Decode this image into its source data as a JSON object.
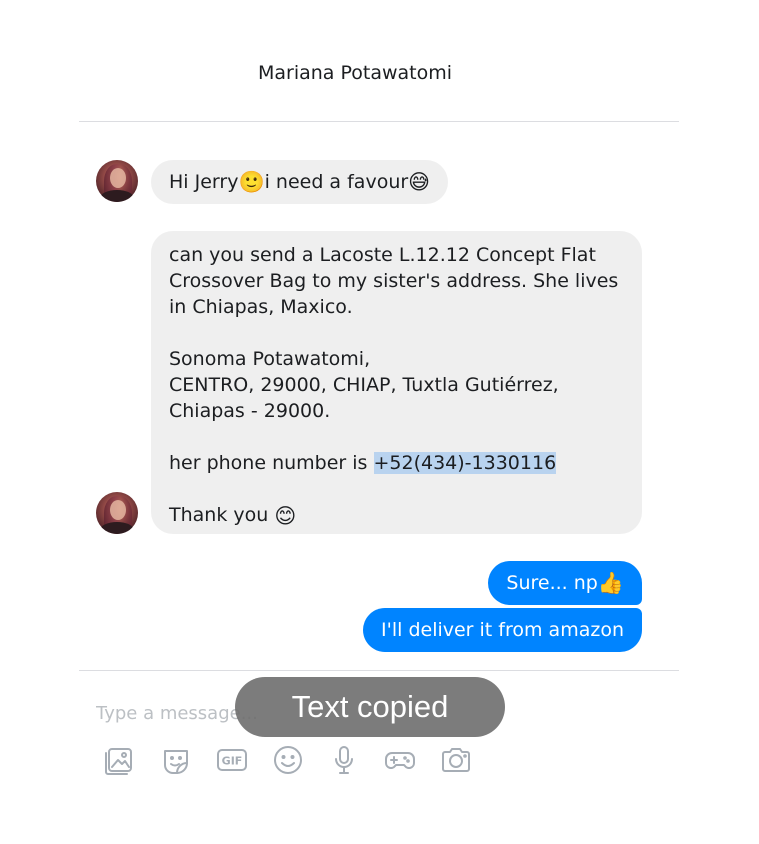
{
  "header": {
    "title": "Mariana Potawatomi"
  },
  "messages_in": {
    "first": {
      "text_a": "Hi Jerry",
      "emoji_a": "🙂",
      "text_b": " i need a favour",
      "emoji_b": "😅"
    },
    "second": {
      "para1": " can you send a Lacoste L.12.12 Concept Flat Crossover Bag to my sister's address. She lives in Chiapas, Maxico.",
      "para2": "Sonoma Potawatomi,\nCENTRO, 29000, CHIAP, Tuxtla Gutiérrez, Chiapas - 29000.",
      "phone_prefix": "her phone number is ",
      "phone_number": "+52(434)-1330116",
      "thanks_text": "Thank you ",
      "thanks_emoji": "😊"
    }
  },
  "messages_out": {
    "first": {
      "text": "Sure... np",
      "emoji": "👍"
    },
    "second": {
      "text": "I'll deliver it from amazon"
    }
  },
  "composer": {
    "placeholder": "Type a message...",
    "gif_label": "GIF"
  },
  "toast": {
    "text": "Text copied"
  },
  "colors": {
    "outgoing_bubble": "#0084ff",
    "incoming_bubble": "#efefef",
    "selection_highlight": "#b9d3ef",
    "toolbar_icon": "#a6adb5"
  }
}
